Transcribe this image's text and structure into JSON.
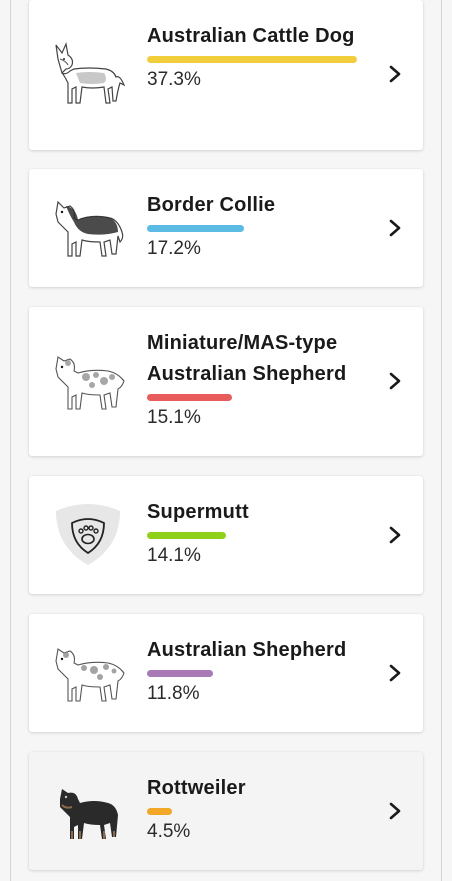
{
  "breeds": [
    {
      "name": "Australian Cattle Dog",
      "percent": "37.3%",
      "value": 37.3,
      "color": "#f2cd3c",
      "icon": "cattle-dog-illustration"
    },
    {
      "name": "Border Collie",
      "percent": "17.2%",
      "value": 17.2,
      "color": "#5bbbe4",
      "icon": "border-collie-illustration"
    },
    {
      "name": "Miniature/MAS-type Australian Shepherd",
      "percent": "15.1%",
      "value": 15.1,
      "color": "#e85c5c",
      "icon": "mini-aussie-illustration"
    },
    {
      "name": "Supermutt",
      "percent": "14.1%",
      "value": 14.1,
      "color": "#8fd11a",
      "icon": "paw-shield-icon"
    },
    {
      "name": "Australian Shepherd",
      "percent": "11.8%",
      "value": 11.8,
      "color": "#a97ab6",
      "icon": "aussie-illustration"
    },
    {
      "name": "Rottweiler",
      "percent": "4.5%",
      "value": 4.5,
      "color": "#f2a726",
      "icon": "rottweiler-illustration"
    }
  ]
}
